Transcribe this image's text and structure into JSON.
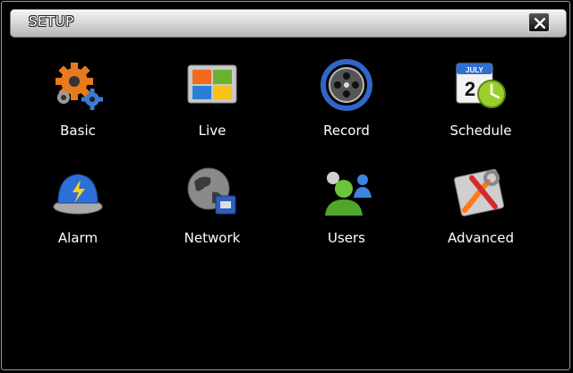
{
  "window": {
    "title": "SETUP",
    "close_icon": "close-icon"
  },
  "menu": [
    {
      "id": "basic",
      "label": "Basic",
      "icon": "gears-icon"
    },
    {
      "id": "live",
      "label": "Live",
      "icon": "monitor-icon"
    },
    {
      "id": "record",
      "label": "Record",
      "icon": "film-reel-icon"
    },
    {
      "id": "schedule",
      "label": "Schedule",
      "icon": "calendar-clock-icon",
      "calendar_month": "JULY",
      "calendar_day": "2"
    },
    {
      "id": "alarm",
      "label": "Alarm",
      "icon": "alarm-bell-icon"
    },
    {
      "id": "network",
      "label": "Network",
      "icon": "globe-network-icon"
    },
    {
      "id": "users",
      "label": "Users",
      "icon": "users-icon"
    },
    {
      "id": "advanced",
      "label": "Advanced",
      "icon": "tools-icon"
    }
  ]
}
